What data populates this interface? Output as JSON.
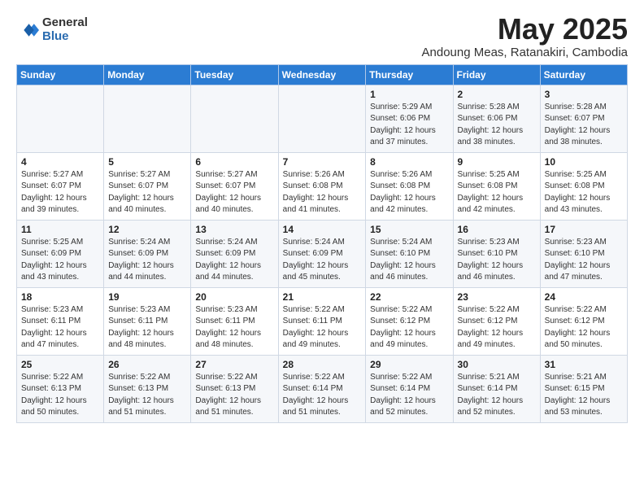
{
  "logo": {
    "general": "General",
    "blue": "Blue"
  },
  "title": "May 2025",
  "subtitle": "Andoung Meas, Ratanakiri, Cambodia",
  "days_header": [
    "Sunday",
    "Monday",
    "Tuesday",
    "Wednesday",
    "Thursday",
    "Friday",
    "Saturday"
  ],
  "weeks": [
    [
      {
        "day": "",
        "detail": ""
      },
      {
        "day": "",
        "detail": ""
      },
      {
        "day": "",
        "detail": ""
      },
      {
        "day": "",
        "detail": ""
      },
      {
        "day": "1",
        "detail": "Sunrise: 5:29 AM\nSunset: 6:06 PM\nDaylight: 12 hours\nand 37 minutes."
      },
      {
        "day": "2",
        "detail": "Sunrise: 5:28 AM\nSunset: 6:06 PM\nDaylight: 12 hours\nand 38 minutes."
      },
      {
        "day": "3",
        "detail": "Sunrise: 5:28 AM\nSunset: 6:07 PM\nDaylight: 12 hours\nand 38 minutes."
      }
    ],
    [
      {
        "day": "4",
        "detail": "Sunrise: 5:27 AM\nSunset: 6:07 PM\nDaylight: 12 hours\nand 39 minutes."
      },
      {
        "day": "5",
        "detail": "Sunrise: 5:27 AM\nSunset: 6:07 PM\nDaylight: 12 hours\nand 40 minutes."
      },
      {
        "day": "6",
        "detail": "Sunrise: 5:27 AM\nSunset: 6:07 PM\nDaylight: 12 hours\nand 40 minutes."
      },
      {
        "day": "7",
        "detail": "Sunrise: 5:26 AM\nSunset: 6:08 PM\nDaylight: 12 hours\nand 41 minutes."
      },
      {
        "day": "8",
        "detail": "Sunrise: 5:26 AM\nSunset: 6:08 PM\nDaylight: 12 hours\nand 42 minutes."
      },
      {
        "day": "9",
        "detail": "Sunrise: 5:25 AM\nSunset: 6:08 PM\nDaylight: 12 hours\nand 42 minutes."
      },
      {
        "day": "10",
        "detail": "Sunrise: 5:25 AM\nSunset: 6:08 PM\nDaylight: 12 hours\nand 43 minutes."
      }
    ],
    [
      {
        "day": "11",
        "detail": "Sunrise: 5:25 AM\nSunset: 6:09 PM\nDaylight: 12 hours\nand 43 minutes."
      },
      {
        "day": "12",
        "detail": "Sunrise: 5:24 AM\nSunset: 6:09 PM\nDaylight: 12 hours\nand 44 minutes."
      },
      {
        "day": "13",
        "detail": "Sunrise: 5:24 AM\nSunset: 6:09 PM\nDaylight: 12 hours\nand 44 minutes."
      },
      {
        "day": "14",
        "detail": "Sunrise: 5:24 AM\nSunset: 6:09 PM\nDaylight: 12 hours\nand 45 minutes."
      },
      {
        "day": "15",
        "detail": "Sunrise: 5:24 AM\nSunset: 6:10 PM\nDaylight: 12 hours\nand 46 minutes."
      },
      {
        "day": "16",
        "detail": "Sunrise: 5:23 AM\nSunset: 6:10 PM\nDaylight: 12 hours\nand 46 minutes."
      },
      {
        "day": "17",
        "detail": "Sunrise: 5:23 AM\nSunset: 6:10 PM\nDaylight: 12 hours\nand 47 minutes."
      }
    ],
    [
      {
        "day": "18",
        "detail": "Sunrise: 5:23 AM\nSunset: 6:11 PM\nDaylight: 12 hours\nand 47 minutes."
      },
      {
        "day": "19",
        "detail": "Sunrise: 5:23 AM\nSunset: 6:11 PM\nDaylight: 12 hours\nand 48 minutes."
      },
      {
        "day": "20",
        "detail": "Sunrise: 5:23 AM\nSunset: 6:11 PM\nDaylight: 12 hours\nand 48 minutes."
      },
      {
        "day": "21",
        "detail": "Sunrise: 5:22 AM\nSunset: 6:11 PM\nDaylight: 12 hours\nand 49 minutes."
      },
      {
        "day": "22",
        "detail": "Sunrise: 5:22 AM\nSunset: 6:12 PM\nDaylight: 12 hours\nand 49 minutes."
      },
      {
        "day": "23",
        "detail": "Sunrise: 5:22 AM\nSunset: 6:12 PM\nDaylight: 12 hours\nand 49 minutes."
      },
      {
        "day": "24",
        "detail": "Sunrise: 5:22 AM\nSunset: 6:12 PM\nDaylight: 12 hours\nand 50 minutes."
      }
    ],
    [
      {
        "day": "25",
        "detail": "Sunrise: 5:22 AM\nSunset: 6:13 PM\nDaylight: 12 hours\nand 50 minutes."
      },
      {
        "day": "26",
        "detail": "Sunrise: 5:22 AM\nSunset: 6:13 PM\nDaylight: 12 hours\nand 51 minutes."
      },
      {
        "day": "27",
        "detail": "Sunrise: 5:22 AM\nSunset: 6:13 PM\nDaylight: 12 hours\nand 51 minutes."
      },
      {
        "day": "28",
        "detail": "Sunrise: 5:22 AM\nSunset: 6:14 PM\nDaylight: 12 hours\nand 51 minutes."
      },
      {
        "day": "29",
        "detail": "Sunrise: 5:22 AM\nSunset: 6:14 PM\nDaylight: 12 hours\nand 52 minutes."
      },
      {
        "day": "30",
        "detail": "Sunrise: 5:21 AM\nSunset: 6:14 PM\nDaylight: 12 hours\nand 52 minutes."
      },
      {
        "day": "31",
        "detail": "Sunrise: 5:21 AM\nSunset: 6:15 PM\nDaylight: 12 hours\nand 53 minutes."
      }
    ]
  ]
}
